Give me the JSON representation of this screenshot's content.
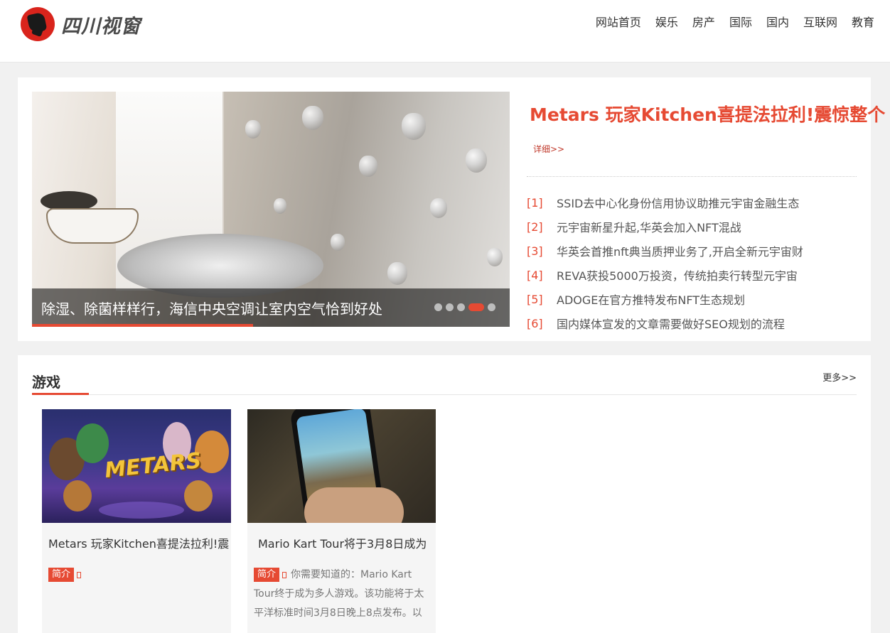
{
  "header": {
    "logo_text": "四川视窗",
    "nav": [
      "网站首页",
      "娱乐",
      "房产",
      "国际",
      "国内",
      "互联网",
      "教育"
    ]
  },
  "featured": {
    "caption": "除湿、除菌样样行，海信中央空调让室内空气恰到好处",
    "slide_count": 5,
    "active_slide": 4,
    "headline": "Metars 玩家Kitchen喜提法拉利!震惊整个",
    "detail_link": "详细>>",
    "news": [
      {
        "num": "[1]",
        "title": "SSID去中心化身份信用协议助推元宇宙金融生态"
      },
      {
        "num": "[2]",
        "title": "元宇宙新星升起,华英会加入NFT混战"
      },
      {
        "num": "[3]",
        "title": "华英会首推nft典当质押业务了,开启全新元宇宙财"
      },
      {
        "num": "[4]",
        "title": "REVA获投5000万投资，传统拍卖行转型元宇宙"
      },
      {
        "num": "[5]",
        "title": "ADOGE在官方推特发布NFT生态规划"
      },
      {
        "num": "[6]",
        "title": "国内媒体宣发的文章需要做好SEO规划的流程"
      }
    ]
  },
  "games": {
    "title": "游戏",
    "more": "更多>>",
    "cards": [
      {
        "title": "Metars 玩家Kitchen喜提法拉利!震",
        "tag": "简介",
        "summary": ""
      },
      {
        "title": "Mario Kart Tour将于3月8日成为",
        "tag": "简介",
        "summary": "你需要知道的：Mario Kart Tour终于成为多人游戏。该功能将于太平洋标准时间3月8日晚上8点发布。以"
      }
    ]
  },
  "colors": {
    "accent": "#e64a33",
    "logo_red": "#d9241c"
  }
}
